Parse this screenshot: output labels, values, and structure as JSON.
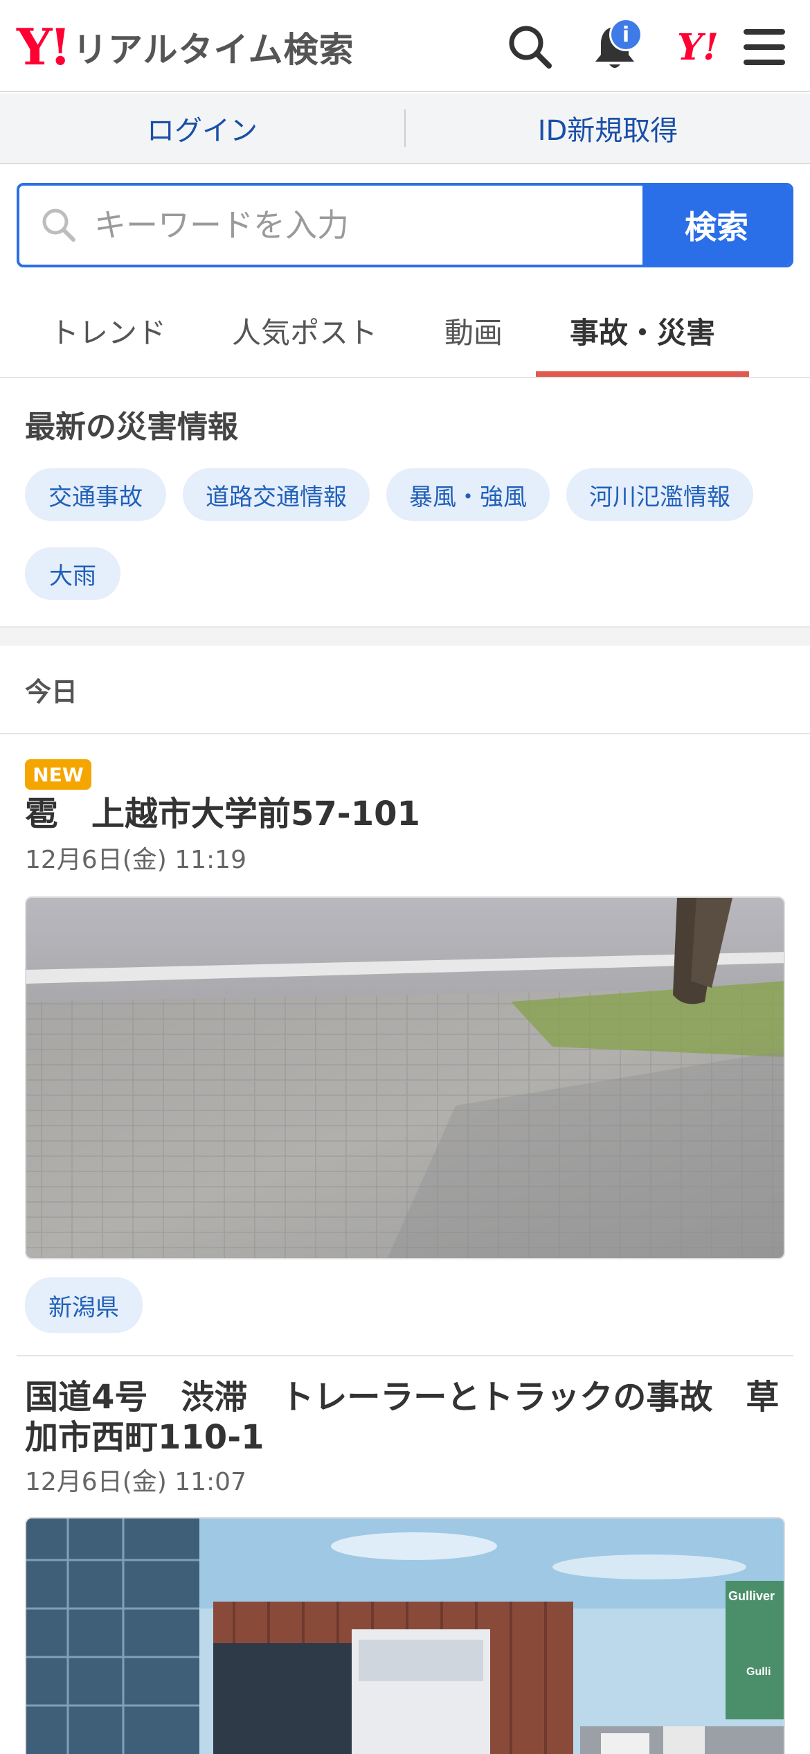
{
  "header": {
    "logo_mark": "Y!",
    "logo_text": "リアルタイム検索",
    "notification_badge": "i",
    "yahoo_small": "Y!"
  },
  "login_bar": {
    "login": "ログイン",
    "register": "ID新規取得"
  },
  "search": {
    "placeholder": "キーワードを入力",
    "button": "検索"
  },
  "tabs": [
    {
      "label": "トレンド",
      "active": false
    },
    {
      "label": "人気ポスト",
      "active": false
    },
    {
      "label": "動画",
      "active": false
    },
    {
      "label": "事故・災害",
      "active": true
    }
  ],
  "disaster_info": {
    "title": "最新の災害情報",
    "chips": [
      "交通事故",
      "道路交通情報",
      "暴風・強風",
      "河川氾濫情報",
      "大雨"
    ]
  },
  "feed": {
    "day_label": "今日",
    "posts": [
      {
        "new_badge": "NEW",
        "title": "雹　上越市大学前57-101",
        "time": "12月6日(金) 11:19",
        "tag": "新潟県"
      },
      {
        "title": "国道4号　渋滞　トレーラーとトラックの事故　草加市西町110-1",
        "time": "12月6日(金) 11:07",
        "photo_signage": [
          "Gulliver",
          "Gulli"
        ]
      }
    ]
  },
  "colors": {
    "brand_red": "#ff0033",
    "link_blue": "#1a4fa8",
    "search_blue": "#2a6fe8",
    "tab_active_underline": "#e05a4f",
    "new_badge": "#f5a500",
    "chip_bg": "#e5eefb"
  },
  "icons": [
    "search-icon",
    "bell-icon",
    "menu-icon"
  ]
}
